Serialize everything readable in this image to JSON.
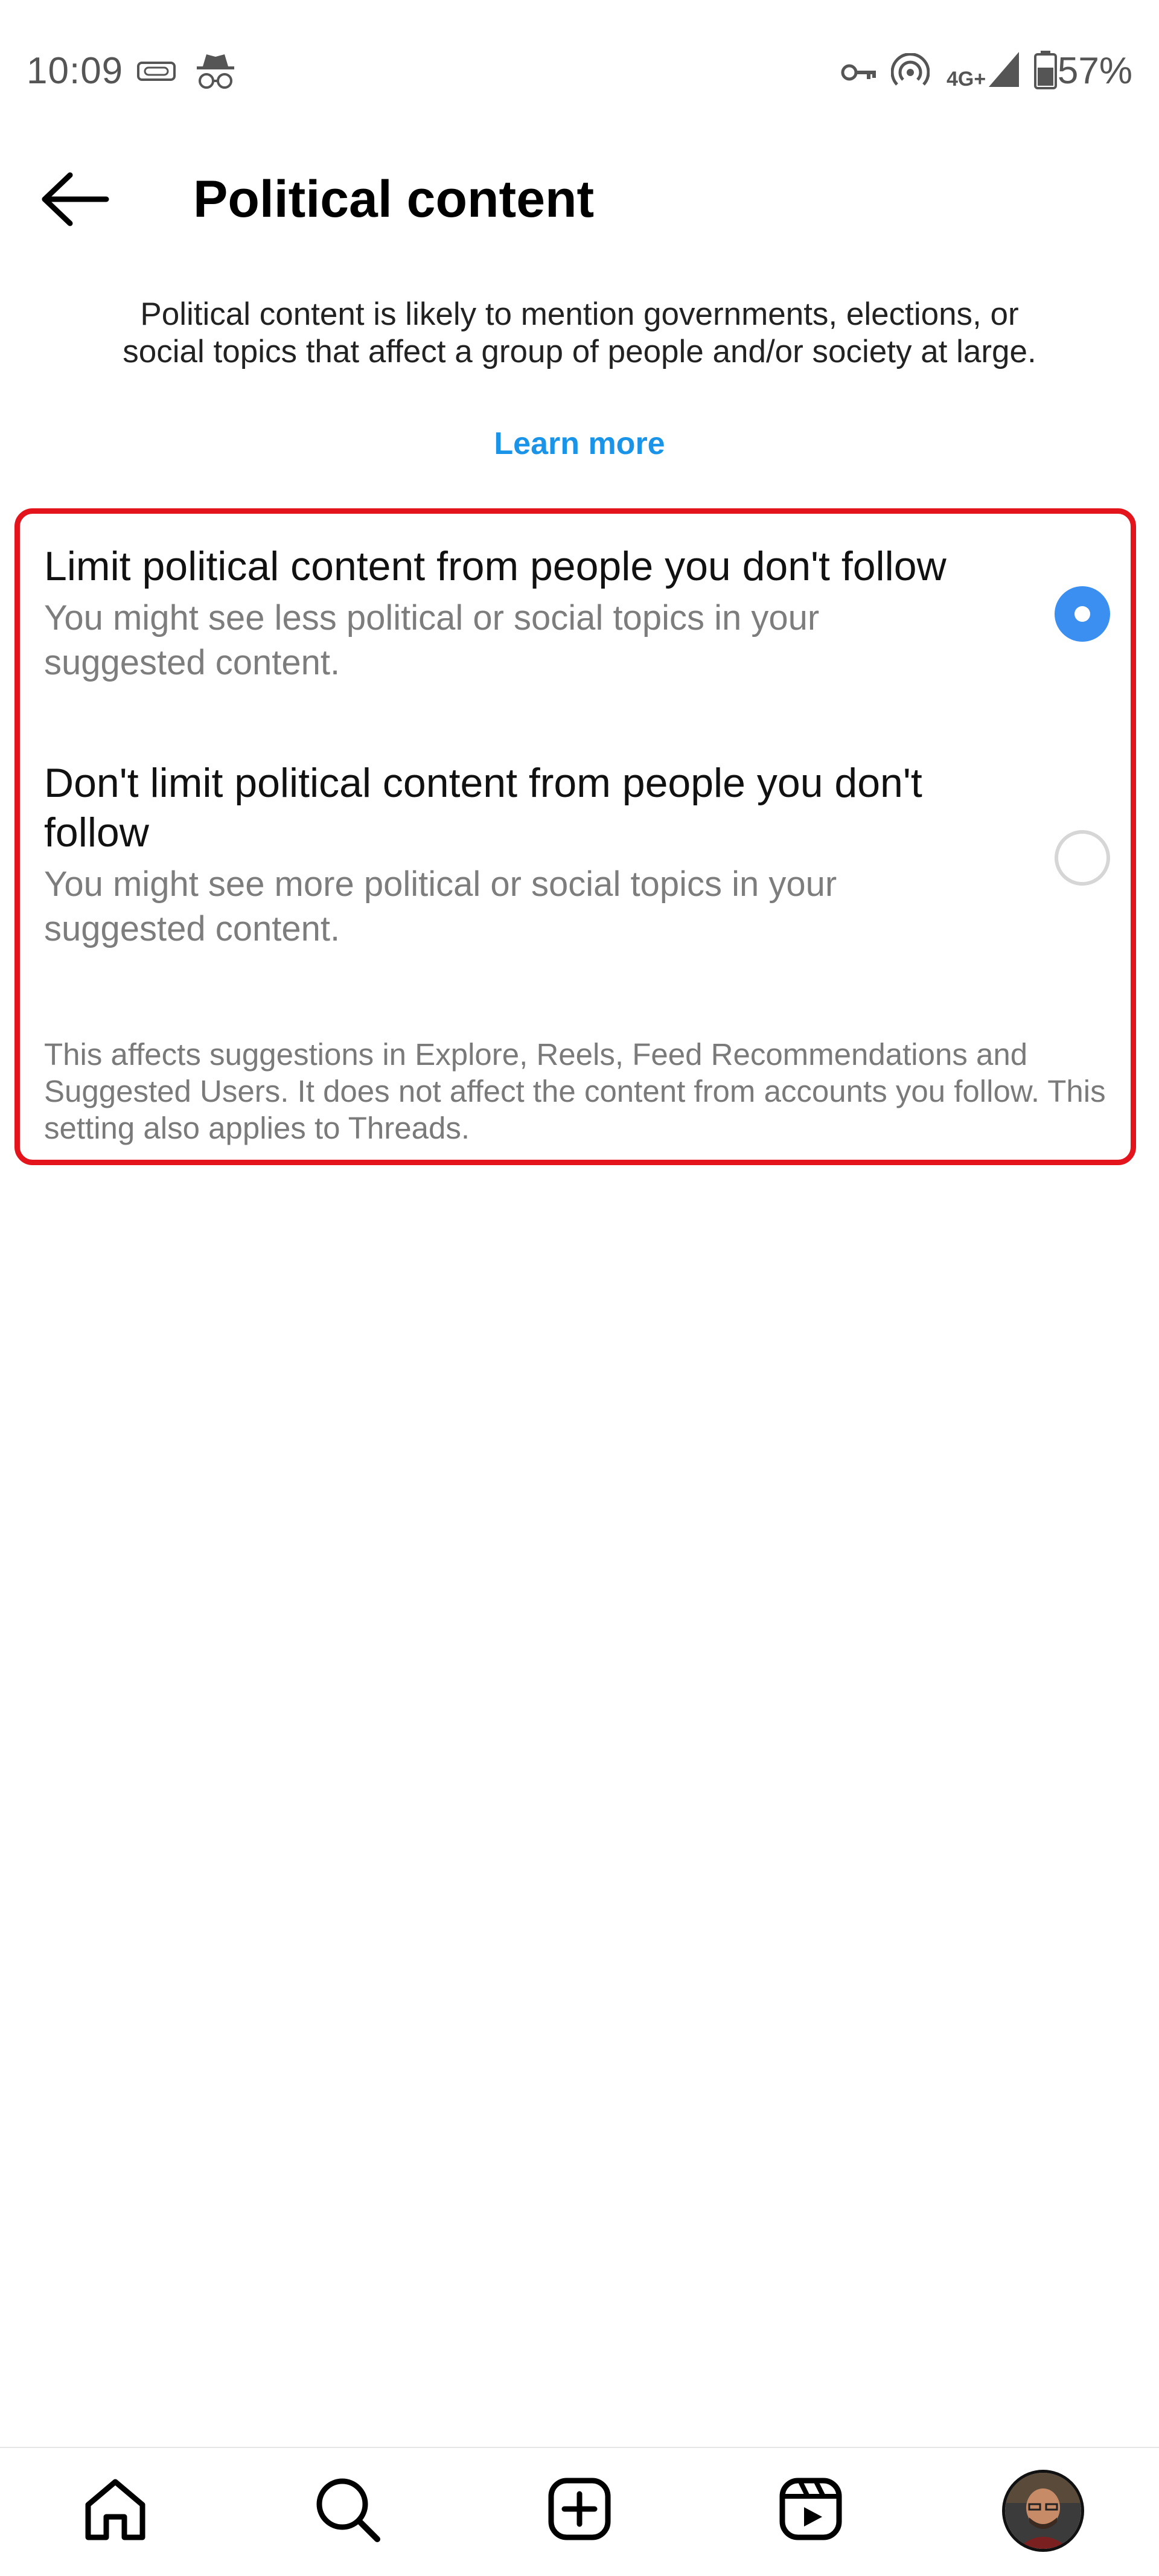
{
  "status_bar": {
    "time": "10:09",
    "network_label": "4G+",
    "battery": "57%",
    "icons": [
      "pill-icon",
      "incognito-icon",
      "key-icon",
      "hotspot-icon",
      "signal-icon",
      "battery-icon"
    ]
  },
  "header": {
    "back_icon": "arrow-left-icon",
    "title": "Political content"
  },
  "description": {
    "text": "Political content is likely to mention governments, elections, or social topics that affect a group of people and/or society at large.",
    "learn_more": "Learn more",
    "link_color": "#1a94e8"
  },
  "options": [
    {
      "title": "Limit political content from people you don't follow",
      "subtitle": "You might see less political or social topics in your suggested content.",
      "selected": true
    },
    {
      "title": "Don't limit political content from people you don't follow",
      "subtitle": "You might see more political or social topics in your suggested content.",
      "selected": false
    }
  ],
  "footnote": "This affects suggestions in Explore, Reels, Feed Recommendations and Suggested Users. It does not affect the content from accounts you follow. This setting also applies to Threads.",
  "highlight_color": "#e3141b",
  "radio_color": "#3b8ff0",
  "bottom_nav": {
    "items": [
      "home-icon",
      "search-icon",
      "create-icon",
      "reels-icon",
      "profile-avatar"
    ]
  }
}
